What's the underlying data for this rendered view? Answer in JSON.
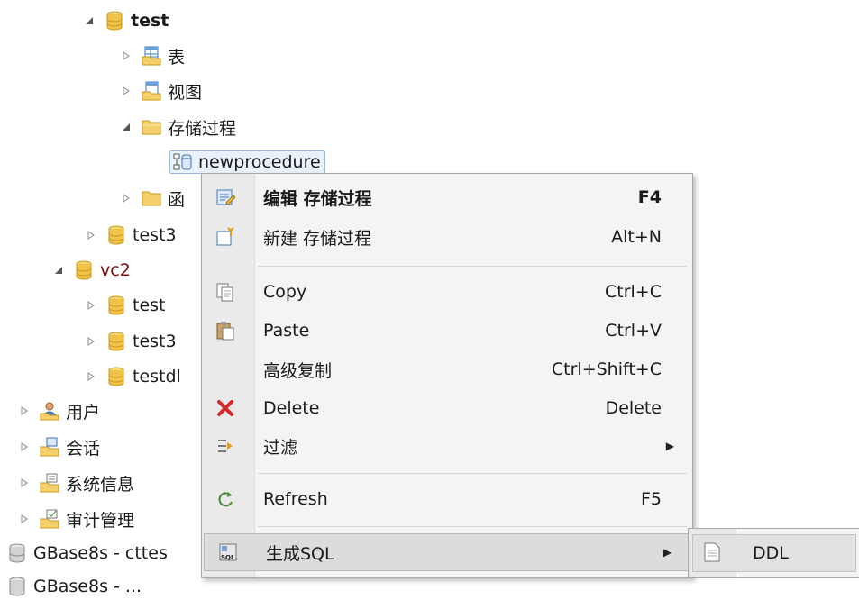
{
  "tree": {
    "db_test": "test",
    "tables": "表",
    "views": "视图",
    "procedures": "存储过程",
    "proc_item": "newprocedure",
    "functions": "函",
    "db_test3": "test3",
    "db_vc2": "vc2",
    "vc2_test": "test",
    "vc2_test3": "test3",
    "vc2_testdl": "testdl",
    "users": "用户",
    "sessions": "会话",
    "sysinfo": "系统信息",
    "audit": "审计管理",
    "conn1": "GBase8s - cttes",
    "conn2": "GBase8s - ..."
  },
  "menu": {
    "edit": {
      "label": "编辑 存储过程",
      "shortcut": "F4"
    },
    "new": {
      "label": "新建 存储过程",
      "shortcut": "Alt+N"
    },
    "copy": {
      "label": "Copy",
      "shortcut": "Ctrl+C"
    },
    "paste": {
      "label": "Paste",
      "shortcut": "Ctrl+V"
    },
    "adv_copy": {
      "label": "高级复制",
      "shortcut": "Ctrl+Shift+C"
    },
    "delete": {
      "label": "Delete",
      "shortcut": "Delete"
    },
    "filter": {
      "label": "过滤"
    },
    "refresh": {
      "label": "Refresh",
      "shortcut": "F5"
    },
    "gen_sql": {
      "label": "生成SQL"
    }
  },
  "submenu": {
    "ddl": "DDL"
  },
  "colors": {
    "db_icon": "#f1c24a",
    "folder": "#f4cf6a",
    "delete_x": "#d42a2a",
    "selection_border": "#99b9d9",
    "menu_bg": "#f4f4f4"
  },
  "icons": [
    "database-icon",
    "table-folder-icon",
    "view-folder-icon",
    "folder-icon",
    "procedure-icon",
    "user-icon",
    "session-icon",
    "sysinfo-icon",
    "audit-icon",
    "connection-icon",
    "edit-icon",
    "new-icon",
    "copy-icon",
    "paste-icon",
    "delete-icon",
    "filter-icon",
    "refresh-icon",
    "sql-icon",
    "document-icon"
  ]
}
